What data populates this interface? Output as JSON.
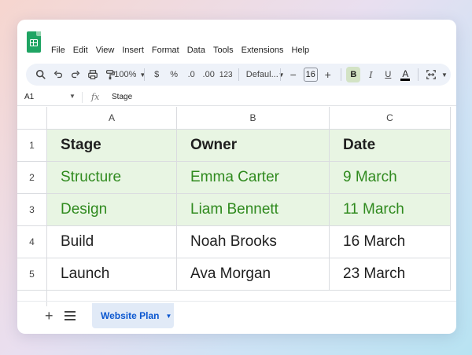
{
  "app": {
    "accent": "#1fa463"
  },
  "menu": [
    "File",
    "Edit",
    "View",
    "Insert",
    "Format",
    "Data",
    "Tools",
    "Extensions",
    "Help"
  ],
  "toolbar": {
    "zoom": "100%",
    "currency": "$",
    "percent": "%",
    "decrease_decimal": ".0",
    "increase_decimal": ".00",
    "number_format": "123",
    "font": "Defaul...",
    "minus": "−",
    "font_size": "16",
    "plus": "+",
    "bold": "B",
    "italic": "I",
    "underline": "U",
    "text_color": "A"
  },
  "formula_bar": {
    "cell_ref": "A1",
    "fx": "fx",
    "value": "Stage"
  },
  "columns": [
    "A",
    "B",
    "C"
  ],
  "rows": [
    "1",
    "2",
    "3",
    "4",
    "5"
  ],
  "cells": [
    [
      "Stage",
      "Owner",
      "Date"
    ],
    [
      "Structure",
      "Emma Carter",
      "9 March"
    ],
    [
      "Design",
      "Liam Bennett",
      "11 March"
    ],
    [
      "Build",
      "Noah Brooks",
      "16 March"
    ],
    [
      "Launch",
      "Ava Morgan",
      "23 March"
    ]
  ],
  "colors": {
    "header_fill": "#e8f5e3",
    "green_text": "#2f8a1e",
    "tab_blue": "#0b57d0"
  },
  "sheet_tab": {
    "add": "+",
    "name": "Website Plan"
  }
}
